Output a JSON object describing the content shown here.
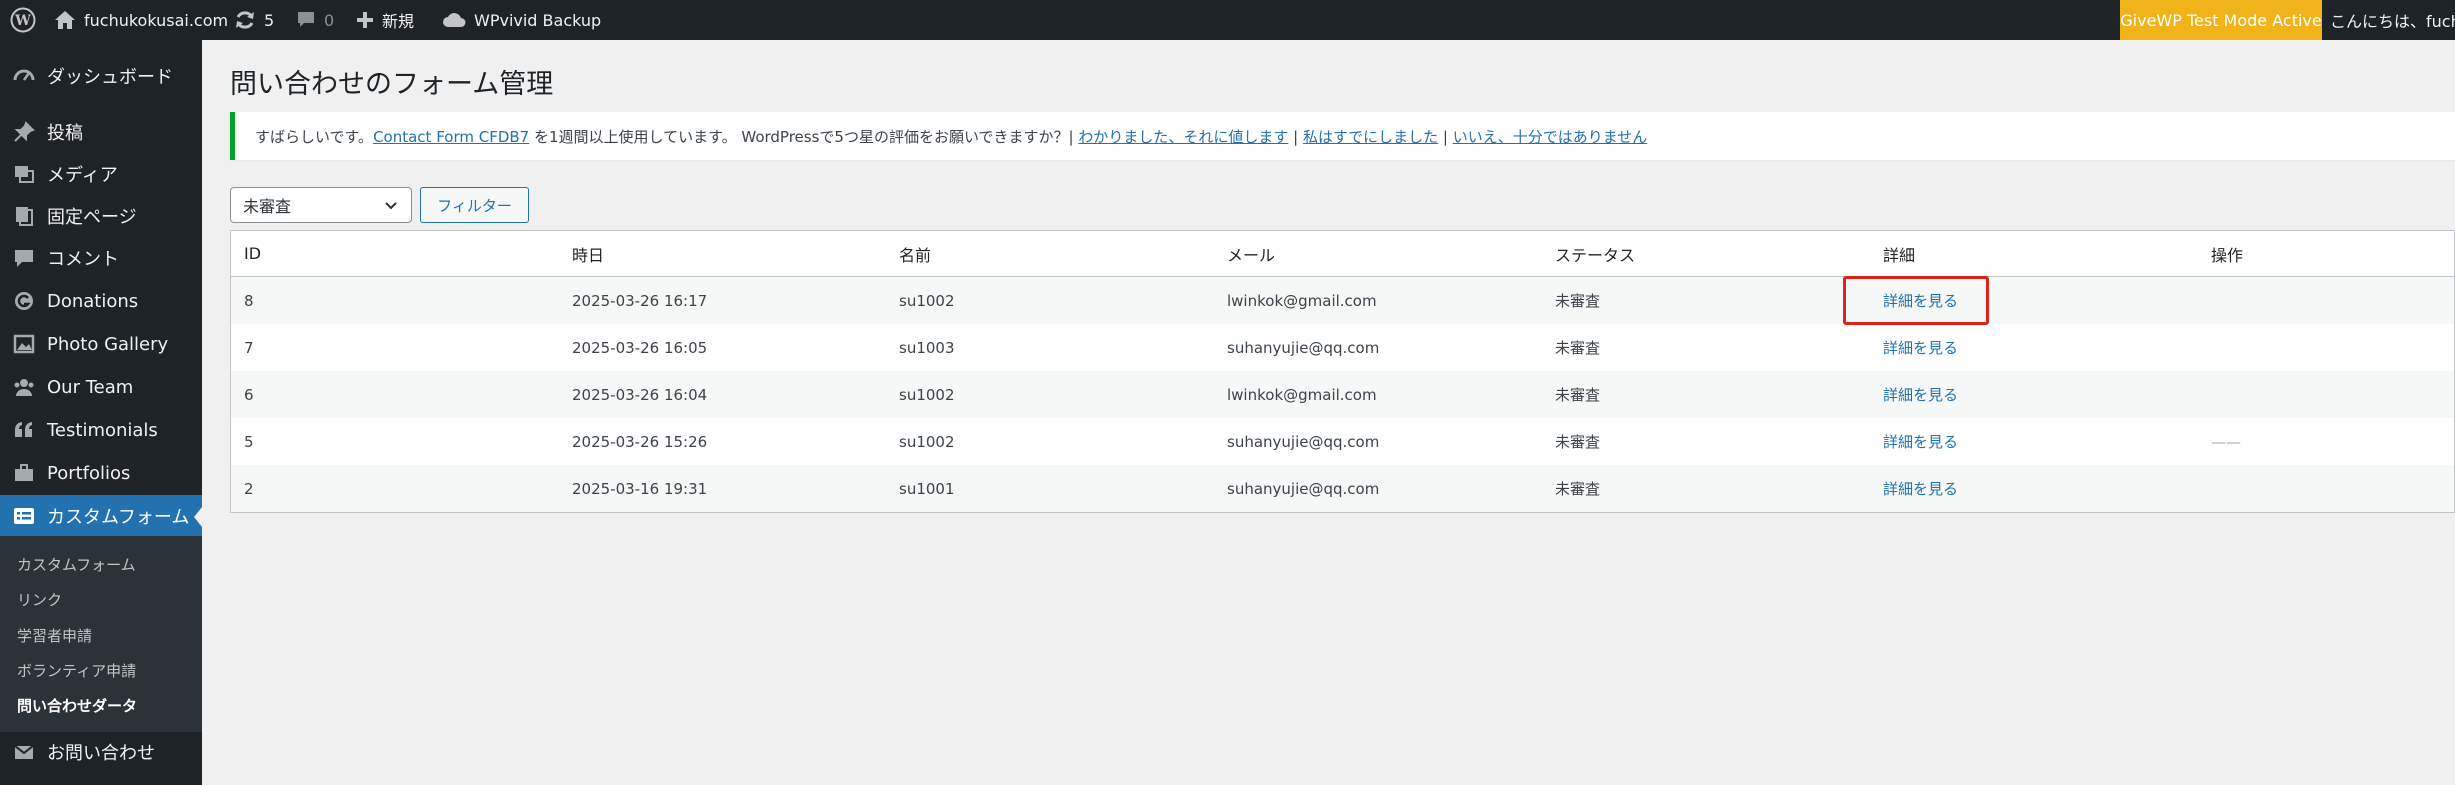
{
  "adminbar": {
    "site_name": "fuchukokusai.com",
    "updates_count": "5",
    "comments_count": "0",
    "new_label": "新規",
    "backup_label": "WPvivid Backup",
    "givewp_label": "GiveWP Test Mode Active",
    "greeting": "こんにちは、fuch"
  },
  "sidebar": {
    "items": [
      {
        "label": "ダッシュボード",
        "icon": "dashboard-icon"
      },
      {
        "label": "投稿",
        "icon": "pin-icon"
      },
      {
        "label": "メディア",
        "icon": "media-icon"
      },
      {
        "label": "固定ページ",
        "icon": "pages-icon"
      },
      {
        "label": "コメント",
        "icon": "comment-icon"
      },
      {
        "label": "Donations",
        "icon": "give-icon"
      },
      {
        "label": "Photo Gallery",
        "icon": "gallery-icon"
      },
      {
        "label": "Our Team",
        "icon": "team-icon"
      },
      {
        "label": "Testimonials",
        "icon": "quote-icon"
      },
      {
        "label": "Portfolios",
        "icon": "portfolio-icon"
      },
      {
        "label": "カスタムフォーム",
        "icon": "form-icon"
      },
      {
        "label": "お問い合わせ",
        "icon": "mail-icon"
      }
    ],
    "submenu": [
      "カスタムフォーム",
      "リンク",
      "学習者申請",
      "ボランティア申請",
      "問い合わせダータ"
    ]
  },
  "page": {
    "title": "問い合わせのフォーム管理"
  },
  "notice": {
    "text_before": "すばらしいです。",
    "plugin_link": "Contact Form CFDB7",
    "text_middle": " を1週間以上使用しています。 WordPressで5つ星の評価をお願いできますか？| ",
    "link_ok": "わかりました、それに値します",
    "sep1": " | ",
    "link_done": "私はすでにしました",
    "sep2": " | ",
    "link_no": "いいえ、十分ではありません"
  },
  "filter": {
    "selected": "未審査",
    "button_label": "フィルター"
  },
  "table": {
    "columns": [
      "ID",
      "時日",
      "名前",
      "メール",
      "ステータス",
      "詳細",
      "操作"
    ],
    "rows": [
      {
        "id": "8",
        "datetime": "2025-03-26 16:17",
        "name": "su1002",
        "email": "lwinkok@gmail.com",
        "status": "未審査",
        "detail": "詳細を見る",
        "action": ""
      },
      {
        "id": "7",
        "datetime": "2025-03-26 16:05",
        "name": "su1003",
        "email": "suhanyujie@qq.com",
        "status": "未審査",
        "detail": "詳細を見る",
        "action": ""
      },
      {
        "id": "6",
        "datetime": "2025-03-26 16:04",
        "name": "su1002",
        "email": "lwinkok@gmail.com",
        "status": "未審査",
        "detail": "詳細を見る",
        "action": ""
      },
      {
        "id": "5",
        "datetime": "2025-03-26 15:26",
        "name": "su1002",
        "email": "suhanyujie@qq.com",
        "status": "未審査",
        "detail": "詳細を見る",
        "action": "——"
      },
      {
        "id": "2",
        "datetime": "2025-03-16 19:31",
        "name": "su1001",
        "email": "suhanyujie@qq.com",
        "status": "未審査",
        "detail": "詳細を見る",
        "action": ""
      }
    ]
  },
  "colors": {
    "adminbar_bg": "#1d2327",
    "accent": "#2271b1",
    "givewp_bg": "#f0b31a",
    "notice_border": "#00a32a",
    "highlight": "#e0201b"
  }
}
